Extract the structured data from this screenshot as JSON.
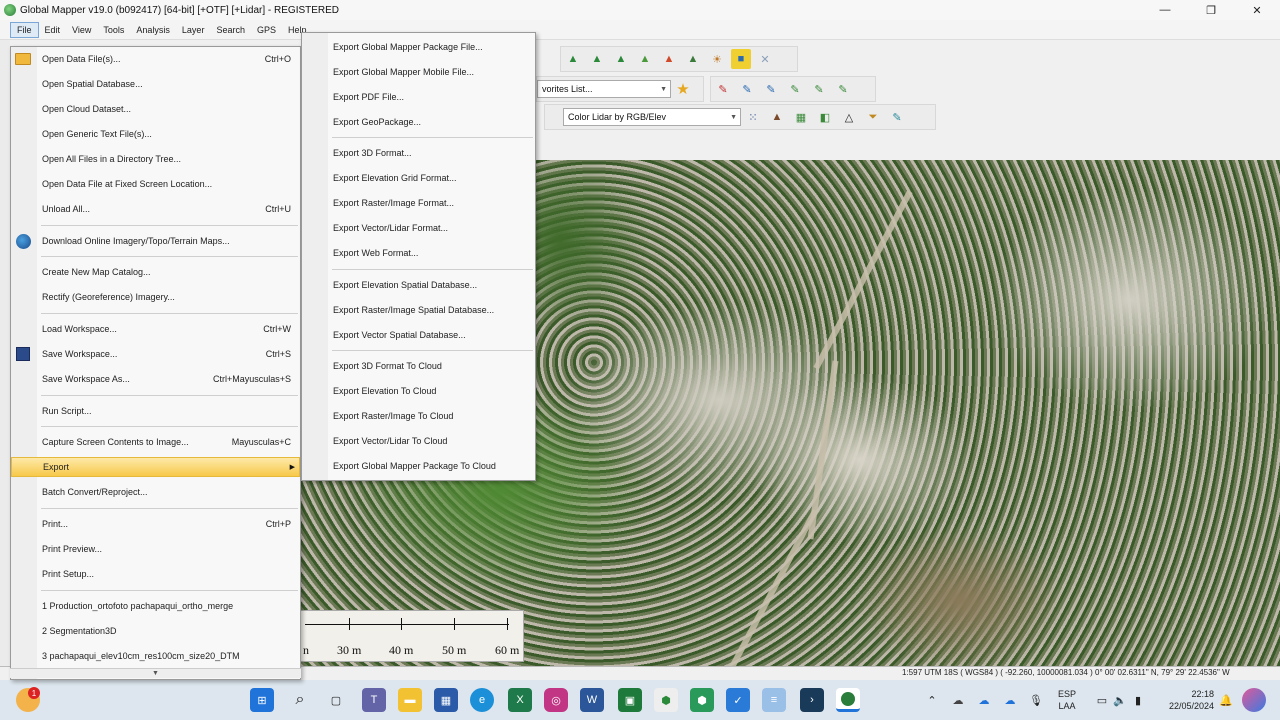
{
  "window": {
    "title": "Global Mapper v19.0 (b092417) [64-bit] [+OTF] [+Lidar] - REGISTERED",
    "minimize": "—",
    "maximize": "❐",
    "close": "✕"
  },
  "menubar": [
    "File",
    "Edit",
    "View",
    "Tools",
    "Analysis",
    "Layer",
    "Search",
    "GPS",
    "Help"
  ],
  "toolbar": {
    "favorites_select": "vorites List...",
    "shader_select": "Color Lidar by RGB/Elev"
  },
  "file_menu": {
    "items": [
      {
        "label": "Open Data File(s)...",
        "shortcut": "Ctrl+O",
        "icon": "folder-icon"
      },
      {
        "label": "Open Spatial Database...",
        "shortcut": ""
      },
      {
        "label": "Open Cloud Dataset...",
        "shortcut": ""
      },
      {
        "label": "Open Generic Text File(s)...",
        "shortcut": ""
      },
      {
        "label": "Open All Files in a Directory Tree...",
        "shortcut": ""
      },
      {
        "label": "Open Data File at Fixed Screen Location...",
        "shortcut": ""
      },
      {
        "label": "Unload All...",
        "shortcut": "Ctrl+U"
      },
      {
        "label": "Download Online Imagery/Topo/Terrain Maps...",
        "shortcut": "",
        "icon": "globe-icon"
      },
      {
        "label": "Create New Map Catalog...",
        "shortcut": ""
      },
      {
        "label": "Rectify (Georeference) Imagery...",
        "shortcut": ""
      },
      {
        "label": "Load Workspace...",
        "shortcut": "Ctrl+W"
      },
      {
        "label": "Save Workspace...",
        "shortcut": "Ctrl+S",
        "icon": "save-icon"
      },
      {
        "label": "Save Workspace As...",
        "shortcut": "Ctrl+Mayusculas+S"
      },
      {
        "label": "Run Script...",
        "shortcut": ""
      },
      {
        "label": "Capture Screen Contents to Image...",
        "shortcut": "Mayusculas+C"
      },
      {
        "label": "Export",
        "shortcut": ""
      },
      {
        "label": "Batch Convert/Reproject...",
        "shortcut": ""
      },
      {
        "label": "Print...",
        "shortcut": "Ctrl+P"
      },
      {
        "label": "Print Preview...",
        "shortcut": ""
      },
      {
        "label": "Print Setup...",
        "shortcut": ""
      },
      {
        "label": "1 Production_ortofoto pachapaqui_ortho_merge",
        "shortcut": ""
      },
      {
        "label": "2 Segmentation3D",
        "shortcut": ""
      },
      {
        "label": "3 pachapaqui_elev10cm_res100cm_size20_DTM",
        "shortcut": ""
      }
    ]
  },
  "export_submenu": {
    "items": [
      "Export Global Mapper Package File...",
      "Export Global Mapper Mobile File...",
      "Export PDF File...",
      "Export GeoPackage...",
      "Export 3D Format...",
      "Export Elevation Grid Format...",
      "Export Raster/Image Format...",
      "Export Vector/Lidar Format...",
      "Export Web Format...",
      "Export Elevation Spatial Database...",
      "Export Raster/Image Spatial Database...",
      "Export Vector Spatial Database...",
      "Export 3D Format To Cloud",
      "Export Elevation To Cloud",
      "Export Raster/Image To Cloud",
      "Export Vector/Lidar To Cloud",
      "Export Global Mapper Package To Cloud"
    ]
  },
  "scalebar": {
    "labels": [
      "30 m",
      "40 m",
      "50 m",
      "60 m"
    ],
    "partial": "n"
  },
  "statusbar": {
    "text": "1:597  UTM 18S ( WGS84 ) ( -92.260, 10000081.034 )  0° 00' 02.6311\" N, 79° 29' 22.4536\" W"
  },
  "taskbar": {
    "badge": "1",
    "lang": "ESP",
    "lang2": "LAA",
    "time": "22:18",
    "date": "22/05/2024"
  }
}
